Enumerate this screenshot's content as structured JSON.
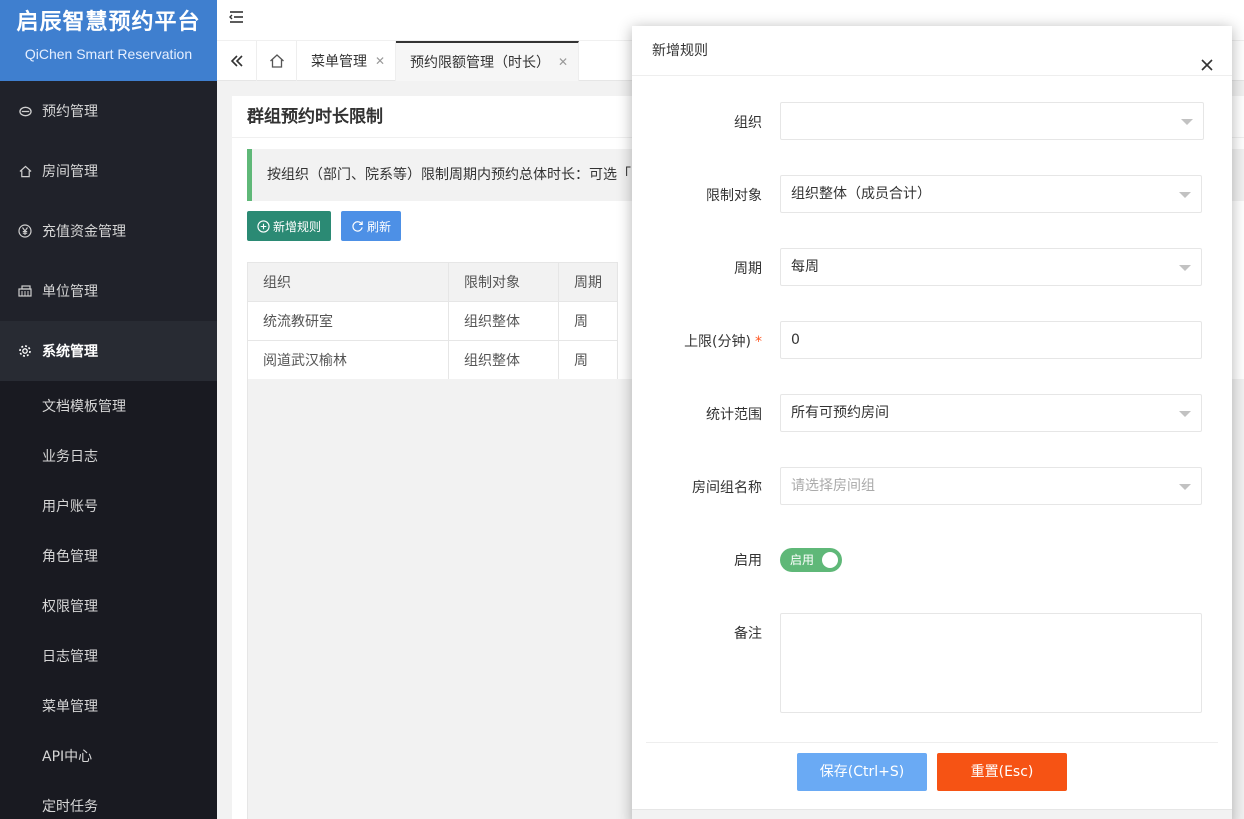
{
  "brand": {
    "title": "启辰智慧预约平台",
    "subtitle": "QiChen Smart Reservation"
  },
  "sidebar": {
    "items": [
      {
        "label": "预约管理",
        "icon": "reservation-icon"
      },
      {
        "label": "房间管理",
        "icon": "home-icon"
      },
      {
        "label": "充值资金管理",
        "icon": "yen-icon"
      },
      {
        "label": "单位管理",
        "icon": "org-icon"
      },
      {
        "label": "系统管理",
        "icon": "gear-icon"
      }
    ],
    "submenu": [
      "文档模板管理",
      "业务日志",
      "用户账号",
      "角色管理",
      "权限管理",
      "日志管理",
      "菜单管理",
      "API中心",
      "定时任务"
    ]
  },
  "tabs": [
    {
      "label": "菜单管理"
    },
    {
      "label": "预约限额管理（时长）"
    }
  ],
  "page": {
    "title": "群组预约时长限制",
    "notice": "按组织（部门、院系等）限制周期内预约总体时长：可选「",
    "add_button": "新增规则",
    "refresh_button": "刷新"
  },
  "table": {
    "headers": [
      "组织",
      "限制对象",
      "周期"
    ],
    "rows": [
      [
        "统流教研室",
        "组织整体",
        "周"
      ],
      [
        "阅道武汉榆林",
        "组织整体",
        "周"
      ]
    ]
  },
  "dialog": {
    "title": "新增规则",
    "fields": {
      "org": {
        "label": "组织",
        "value": ""
      },
      "target": {
        "label": "限制对象",
        "value": "组织整体（成员合计）"
      },
      "period": {
        "label": "周期",
        "value": "每周"
      },
      "limit": {
        "label": "上限(分钟)",
        "required_mark": "*",
        "value": "0"
      },
      "scope": {
        "label": "统计范围",
        "value": "所有可预约房间"
      },
      "room_group": {
        "label": "房间组名称",
        "placeholder": "请选择房间组"
      },
      "enabled": {
        "label": "启用",
        "switch_text": "启用"
      },
      "remark": {
        "label": "备注",
        "value": ""
      }
    },
    "save_button": "保存(Ctrl+S)",
    "reset_button": "重置(Esc)"
  },
  "colors": {
    "sidebar_bg": "#20222a",
    "brand_bg": "#3f7fcf",
    "green": "#5fb878",
    "save": "#6aaaf4",
    "reset": "#f65314"
  }
}
